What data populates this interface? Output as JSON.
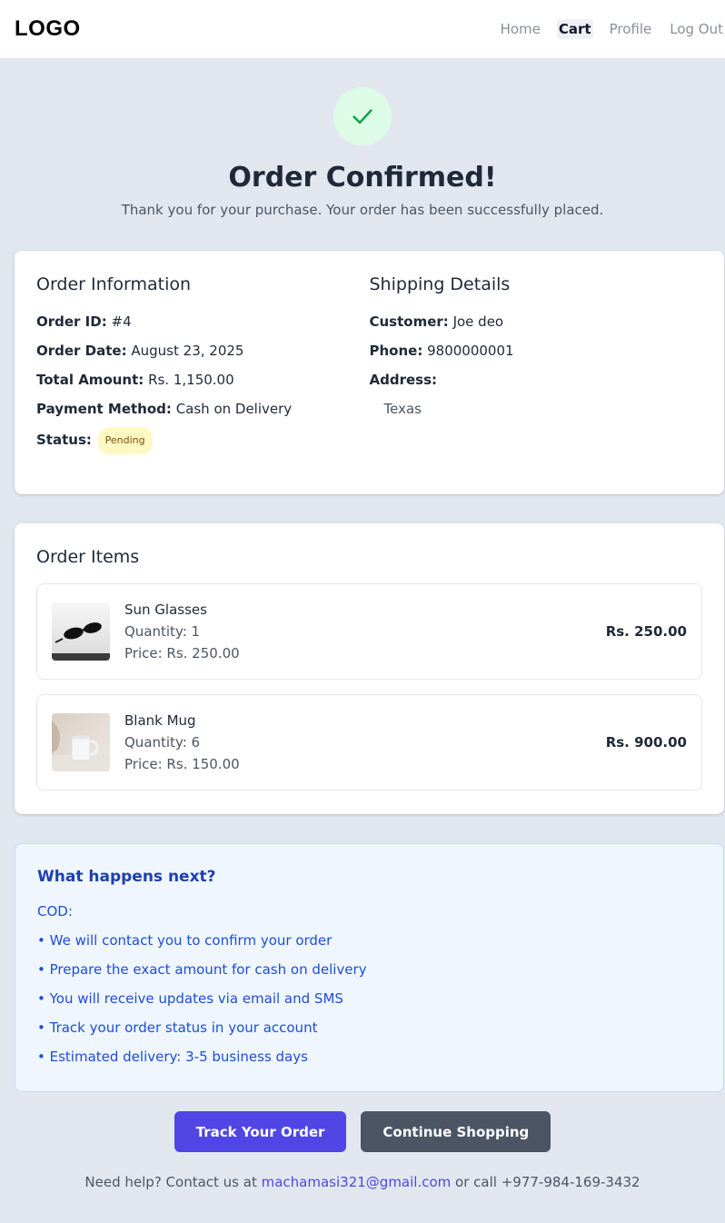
{
  "navbar": {
    "logo": "LOGO",
    "links": [
      "Home",
      "Cart",
      "Profile",
      "Log Out"
    ],
    "active": "Cart"
  },
  "hero": {
    "title": "Order Confirmed!",
    "subtitle": "Thank you for your purchase. Your order has been successfully placed.",
    "icon": "check-icon",
    "icon_color": "#16a34a"
  },
  "order_info": {
    "title": "Order Information",
    "order_id_label": "Order ID:",
    "order_id": "#4",
    "order_date_label": "Order Date:",
    "order_date": "August 23, 2025",
    "total_label": "Total Amount:",
    "total": "Rs. 1,150.00",
    "payment_label": "Payment Method:",
    "payment": "Cash on Delivery",
    "status_label": "Status:",
    "status": "Pending"
  },
  "shipping": {
    "title": "Shipping Details",
    "customer_label": "Customer:",
    "customer": "Joe deo",
    "phone_label": "Phone:",
    "phone": "9800000001",
    "address_label": "Address:",
    "address": "Texas"
  },
  "items": {
    "title": "Order Items",
    "list": [
      {
        "name": "Sun Glasses",
        "quantity": "Quantity: 1",
        "price": "Price: Rs. 250.00",
        "total": "Rs. 250.00"
      },
      {
        "name": "Blank Mug",
        "quantity": "Quantity: 6",
        "price": "Price: Rs. 150.00",
        "total": "Rs. 900.00"
      }
    ]
  },
  "next_steps": {
    "title": "What happens next?",
    "method": "COD:",
    "lines": [
      "• We will contact you to confirm your order",
      "• Prepare the exact amount for cash on delivery",
      "• You will receive updates via email and SMS",
      "• Track your order status in your account",
      "• Estimated delivery: 3-5 business days"
    ]
  },
  "actions": {
    "track": "Track Your Order",
    "continue": "Continue Shopping"
  },
  "help": {
    "prefix": "Need help? Contact us at",
    "email": "machamasi321@gmail.com",
    "suffix": "or call +977-984-169-3432"
  },
  "colors": {
    "accent": "#4f46e5",
    "status_pending_bg": "#fef9c3",
    "info_box_bg": "#eff6ff"
  }
}
